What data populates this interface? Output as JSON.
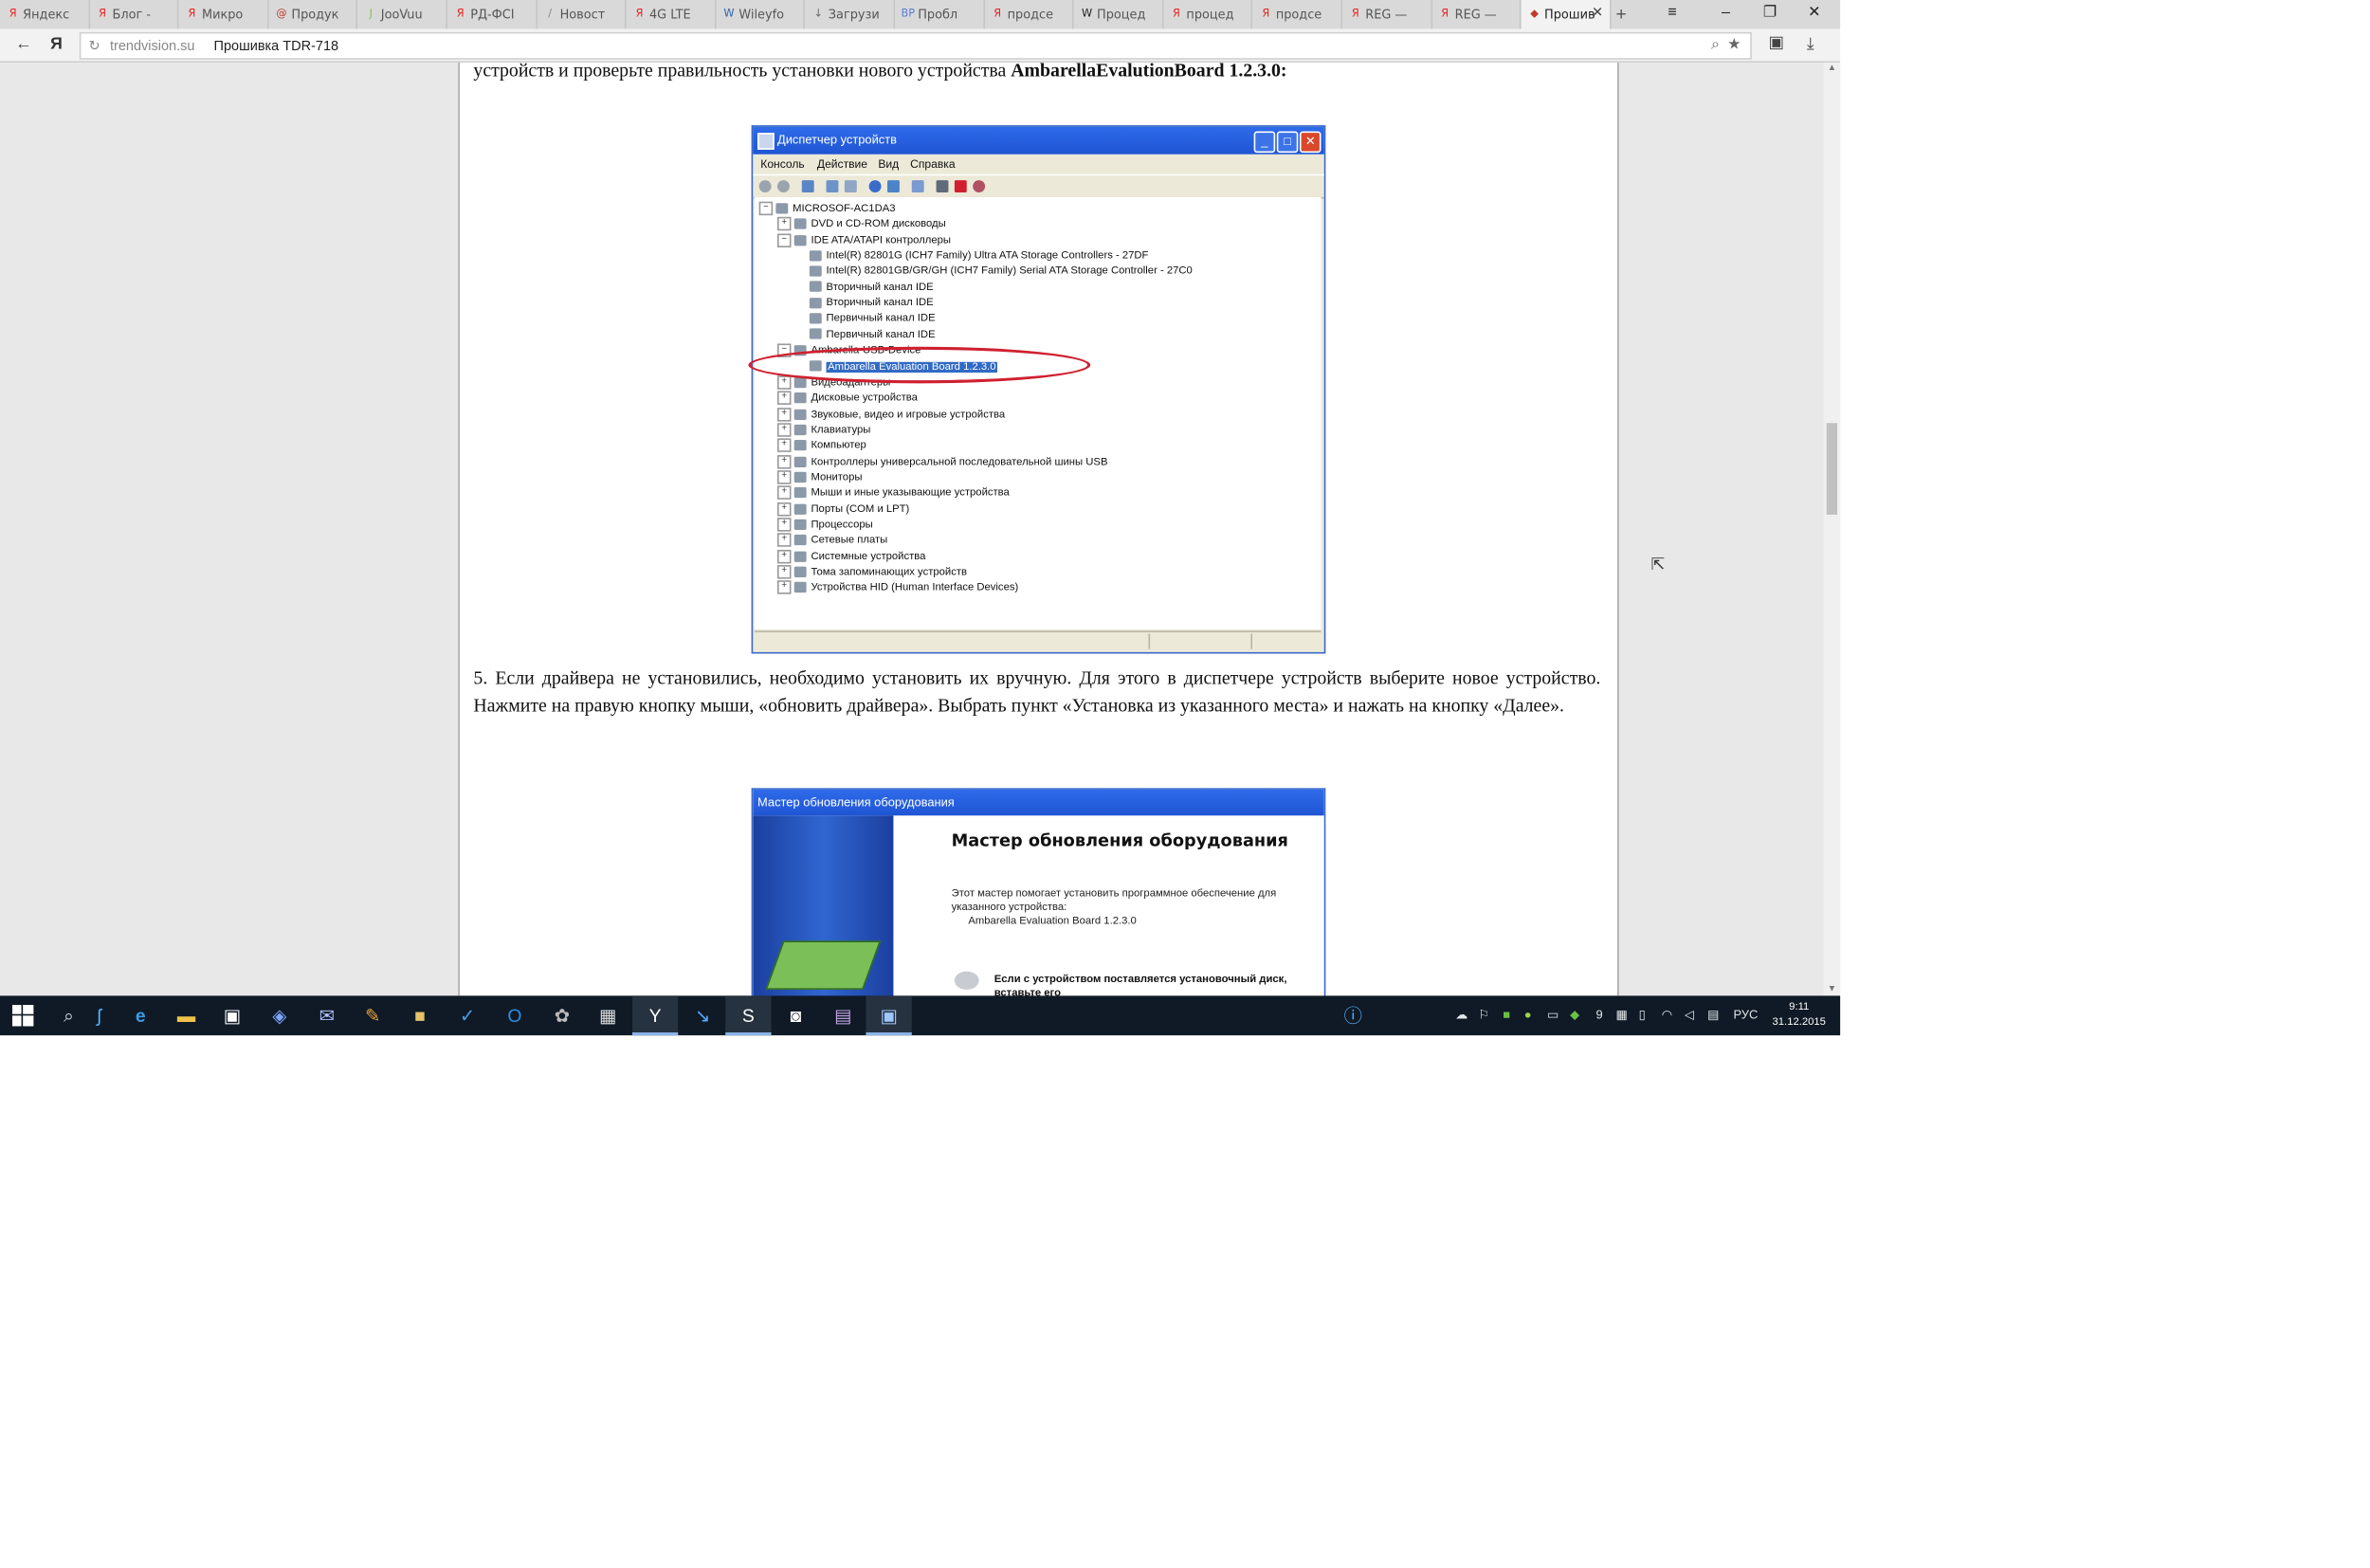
{
  "browser": {
    "tabs": [
      {
        "label": "Яндекс",
        "fav": "Я",
        "color": "#e52620"
      },
      {
        "label": "Блог - ",
        "fav": "Я",
        "color": "#e52620"
      },
      {
        "label": "Микро",
        "fav": "Я",
        "color": "#e52620"
      },
      {
        "label": "Продук",
        "fav": "@",
        "color": "#c0392b"
      },
      {
        "label": "JooVuu",
        "fav": "J",
        "color": "#8bc34a"
      },
      {
        "label": "РД-ФСІ",
        "fav": "Я",
        "color": "#e52620"
      },
      {
        "label": "Новост",
        "fav": "/",
        "color": "#888888"
      },
      {
        "label": "4G LTE",
        "fav": "Я",
        "color": "#e52620"
      },
      {
        "label": "Wileyfo",
        "fav": "W",
        "color": "#2f5fa7"
      },
      {
        "label": "Загрузи",
        "fav": "↓",
        "color": "#666666"
      },
      {
        "label": "Пробл",
        "fav": "BP",
        "color": "#5a7fd6"
      },
      {
        "label": "продсе",
        "fav": "Я",
        "color": "#e52620"
      },
      {
        "label": "Процед",
        "fav": "W",
        "color": "#222222"
      },
      {
        "label": "процед",
        "fav": "Я",
        "color": "#e52620"
      },
      {
        "label": "продсе",
        "fav": "Я",
        "color": "#e52620"
      },
      {
        "label": "REG —",
        "fav": "Я",
        "color": "#e52620"
      },
      {
        "label": "REG —",
        "fav": "Я",
        "color": "#e52620"
      },
      {
        "label": "Прошив",
        "fav": "◆",
        "color": "#c0392b"
      }
    ],
    "new_tab_label": "+",
    "menu_icon": "≡",
    "minimize": "–",
    "restore": "❐",
    "close": "✕",
    "url_domain": "trendvision.su",
    "url_title": "Прошивка TDR-718",
    "yandex_button": "Я"
  },
  "article": {
    "intro_text": "устройств и проверьте правильность установки нового устройства",
    "intro_bold": "AmbarellaEvalutionBoard 1.2.3.0:",
    "step5": "5. Если драйвера не установились, необходимо установить их вручную. Для этого в диспетчере устройств выберите новое устройство. Нажмите на правую кнопку мыши, «обновить драйвера». Выбрать пункт «Установка из указанного места» и нажать на кнопку «Далее»."
  },
  "devmgr": {
    "title": "Диспетчер устройств",
    "menu": [
      "Консоль",
      "Действие",
      "Вид",
      "Справка"
    ],
    "tree": [
      {
        "label": "MICROSOF-AC1DA3",
        "level": 0,
        "pm": "−"
      },
      {
        "label": "DVD и CD-ROM дисководы",
        "level": 1,
        "pm": "+"
      },
      {
        "label": "IDE ATA/ATAPI контроллеры",
        "level": 1,
        "pm": "−"
      },
      {
        "label": "Intel(R) 82801G (ICH7 Family) Ultra ATA Storage Controllers - 27DF",
        "level": 2
      },
      {
        "label": "Intel(R) 82801GB/GR/GH (ICH7 Family) Serial ATA Storage Controller - 27C0",
        "level": 2
      },
      {
        "label": "Вторичный канал IDE",
        "level": 2
      },
      {
        "label": "Вторичный канал IDE",
        "level": 2
      },
      {
        "label": "Первичный канал IDE",
        "level": 2
      },
      {
        "label": "Первичный канал IDE",
        "level": 2
      },
      {
        "label": "Ambarella-USB-Device",
        "level": 1,
        "pm": "−"
      },
      {
        "label": "Ambarella Evaluation Board 1.2.3.0",
        "level": 2,
        "selected": true
      },
      {
        "label": "Видеоадаптеры",
        "level": 1,
        "pm": "+"
      },
      {
        "label": "Дисковые устройства",
        "level": 1,
        "pm": "+"
      },
      {
        "label": "Звуковые, видео и игровые устройства",
        "level": 1,
        "pm": "+"
      },
      {
        "label": "Клавиатуры",
        "level": 1,
        "pm": "+"
      },
      {
        "label": "Компьютер",
        "level": 1,
        "pm": "+"
      },
      {
        "label": "Контроллеры универсальной последовательной шины USB",
        "level": 1,
        "pm": "+"
      },
      {
        "label": "Мониторы",
        "level": 1,
        "pm": "+"
      },
      {
        "label": "Мыши и иные указывающие устройства",
        "level": 1,
        "pm": "+"
      },
      {
        "label": "Порты (COM и LPT)",
        "level": 1,
        "pm": "+"
      },
      {
        "label": "Процессоры",
        "level": 1,
        "pm": "+"
      },
      {
        "label": "Сетевые платы",
        "level": 1,
        "pm": "+"
      },
      {
        "label": "Системные устройства",
        "level": 1,
        "pm": "+"
      },
      {
        "label": "Тома запоминающих устройств",
        "level": 1,
        "pm": "+"
      },
      {
        "label": "Устройства HID (Human Interface Devices)",
        "level": 1,
        "pm": "+"
      }
    ]
  },
  "wizard": {
    "title": "Мастер обновления оборудования",
    "heading": "Мастер обновления оборудования",
    "body1": "Этот мастер помогает установить программное обеспечение для указанного устройства:",
    "device": "Ambarella Evaluation Board 1.2.3.0",
    "body2": "Если с устройством поставляется установочный диск, вставьте его"
  },
  "taskbar": {
    "tray_num": "9",
    "lang": "РУС",
    "time": "9:11",
    "date": "31.12.2015"
  }
}
